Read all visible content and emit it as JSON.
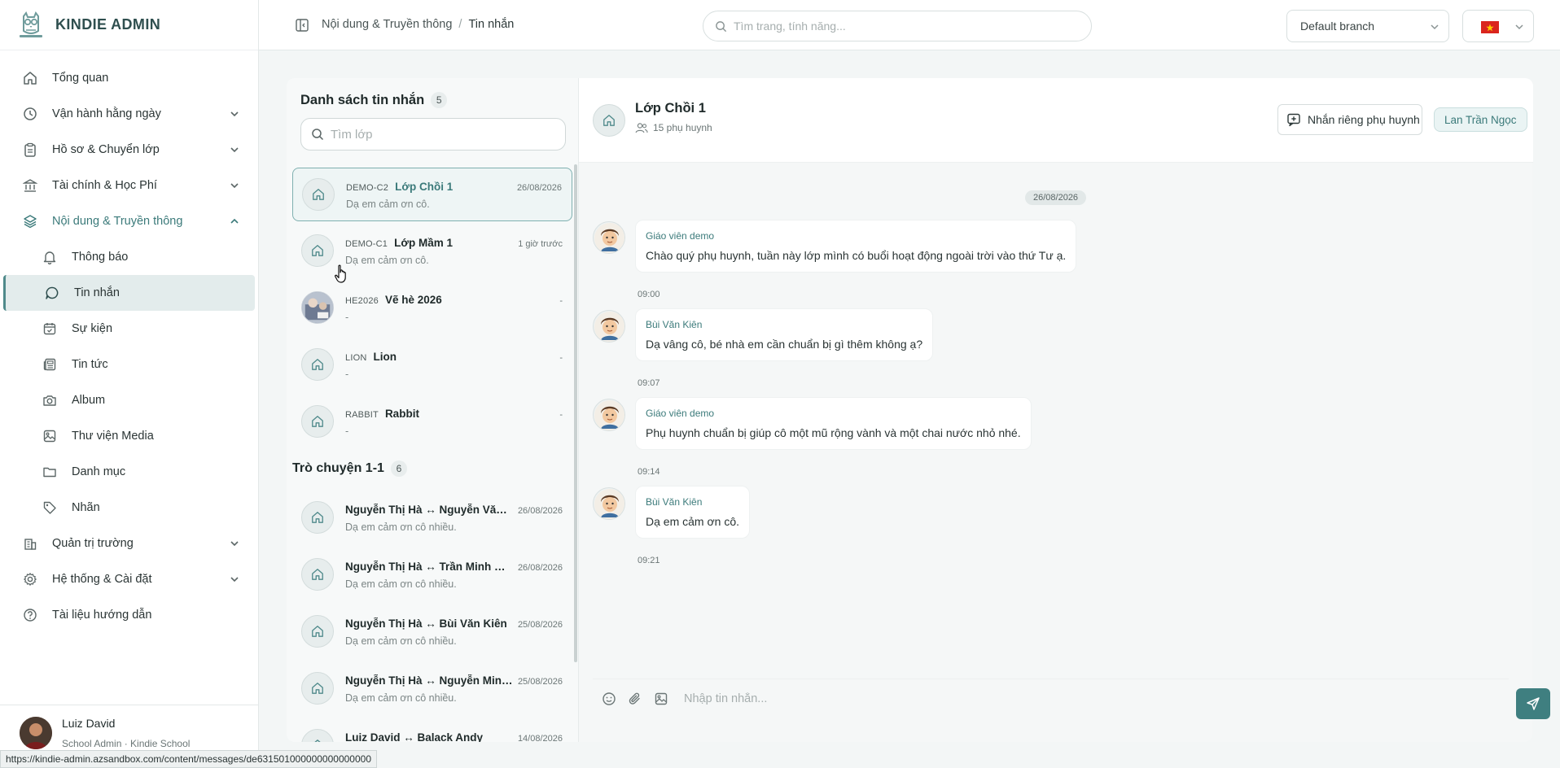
{
  "brand": {
    "name": "KINDIE ADMIN"
  },
  "sidebar": {
    "items": [
      {
        "label": "Tổng quan",
        "icon": "home-icon",
        "expandable": false
      },
      {
        "label": "Vận hành hằng ngày",
        "icon": "clock-icon",
        "expandable": true
      },
      {
        "label": "Hồ sơ & Chuyển lớp",
        "icon": "clipboard-icon",
        "expandable": true
      },
      {
        "label": "Tài chính & Học Phí",
        "icon": "bank-icon",
        "expandable": true
      },
      {
        "label": "Nội dung & Truyền thông",
        "icon": "layers-icon",
        "expandable": true,
        "open": true
      }
    ],
    "subitems": [
      {
        "label": "Thông báo",
        "icon": "bell-icon"
      },
      {
        "label": "Tin nhắn",
        "icon": "message-icon",
        "active": true
      },
      {
        "label": "Sự kiện",
        "icon": "calendar-icon"
      },
      {
        "label": "Tin tức",
        "icon": "newspaper-icon"
      },
      {
        "label": "Album",
        "icon": "camera-icon"
      },
      {
        "label": "Thư viện Media",
        "icon": "image-icon"
      },
      {
        "label": "Danh mục",
        "icon": "folder-icon"
      },
      {
        "label": "Nhãn",
        "icon": "tag-icon"
      }
    ],
    "bottom_items": [
      {
        "label": "Quản trị trường",
        "icon": "building-icon",
        "expandable": true
      },
      {
        "label": "Hệ thống & Cài đặt",
        "icon": "gear-icon",
        "expandable": true
      },
      {
        "label": "Tài liệu hướng dẫn",
        "icon": "help-icon",
        "expandable": false
      }
    ],
    "user": {
      "name": "Luiz David",
      "role": "School Admin · Kindie School"
    }
  },
  "topbar": {
    "breadcrumb": [
      "Nội dung & Truyền thông",
      "Tin nhắn"
    ],
    "search_placeholder": "Tìm trang, tính năng...",
    "branch": "Default branch",
    "language_flag": "vietnam-flag-icon"
  },
  "list": {
    "title": "Danh sách tin nhắn",
    "count": "5",
    "search_placeholder": "Tìm lớp",
    "classes": [
      {
        "code": "DEMO-C2",
        "name": "Lớp Chồi 1",
        "time": "26/08/2026",
        "preview": "Dạ em cảm ơn cô.",
        "active": true,
        "photo": false
      },
      {
        "code": "DEMO-C1",
        "name": "Lớp Mầm 1",
        "time": "1 giờ trước",
        "preview": "Dạ em cảm ơn cô.",
        "active": false,
        "photo": false
      },
      {
        "code": "HE2026",
        "name": "Vẽ hè 2026",
        "time": "-",
        "preview": "-",
        "active": false,
        "photo": true
      },
      {
        "code": "LION",
        "name": "Lion",
        "time": "-",
        "preview": "-",
        "active": false,
        "photo": false
      },
      {
        "code": "RABBIT",
        "name": "Rabbit",
        "time": "-",
        "preview": "-",
        "active": false,
        "photo": false
      }
    ],
    "direct_title": "Trò chuyện 1-1",
    "direct_count": "6",
    "direct": [
      {
        "name": "Nguyễn Thị Hà ↔ Nguyễn Văn A...",
        "time": "26/08/2026",
        "preview": "Dạ em cảm ơn cô nhiều."
      },
      {
        "name": "Nguyễn Thị Hà ↔ Trần Minh Bình",
        "time": "26/08/2026",
        "preview": "Dạ em cảm ơn cô nhiều."
      },
      {
        "name": "Nguyễn Thị Hà ↔ Bùi Văn Kiên",
        "time": "25/08/2026",
        "preview": "Dạ em cảm ơn cô nhiều."
      },
      {
        "name": "Nguyễn Thị Hà ↔ Nguyễn Minh ...",
        "time": "25/08/2026",
        "preview": "Dạ em cảm ơn cô nhiều."
      },
      {
        "name": "Luiz David ↔ Balack Andy",
        "time": "14/08/2026",
        "preview": ""
      }
    ]
  },
  "chat": {
    "title": "Lớp Chồi 1",
    "subtitle": "15 phụ huynh",
    "private_button": "Nhắn riêng phụ huynh",
    "teacher_chip": "Lan Trần Ngọc",
    "date": "26/08/2026",
    "messages": [
      {
        "sender": "Giáo viên demo",
        "text": "Chào quý phụ huynh, tuần này lớp mình có buổi hoạt động ngoài trời vào thứ Tư ạ.",
        "time": "09:00"
      },
      {
        "sender": "Bùi Văn Kiên",
        "text": "Dạ vâng cô, bé nhà em cần chuẩn bị gì thêm không ạ?",
        "time": "09:07"
      },
      {
        "sender": "Giáo viên demo",
        "text": "Phụ huynh chuẩn bị giúp cô một mũ rộng vành và một chai nước nhỏ nhé.",
        "time": "09:14"
      },
      {
        "sender": "Bùi Văn Kiên",
        "text": "Dạ em cảm ơn cô.",
        "time": "09:21"
      }
    ],
    "composer_placeholder": "Nhập tin nhắn..."
  },
  "status_url": "https://kindie-admin.azsandbox.com/content/messages/de631501000000000000000",
  "colors": {
    "accent": "#3f7f80",
    "active_bg": "#e3ecec",
    "flag_red": "#da251d",
    "flag_star": "#ffcd00"
  }
}
